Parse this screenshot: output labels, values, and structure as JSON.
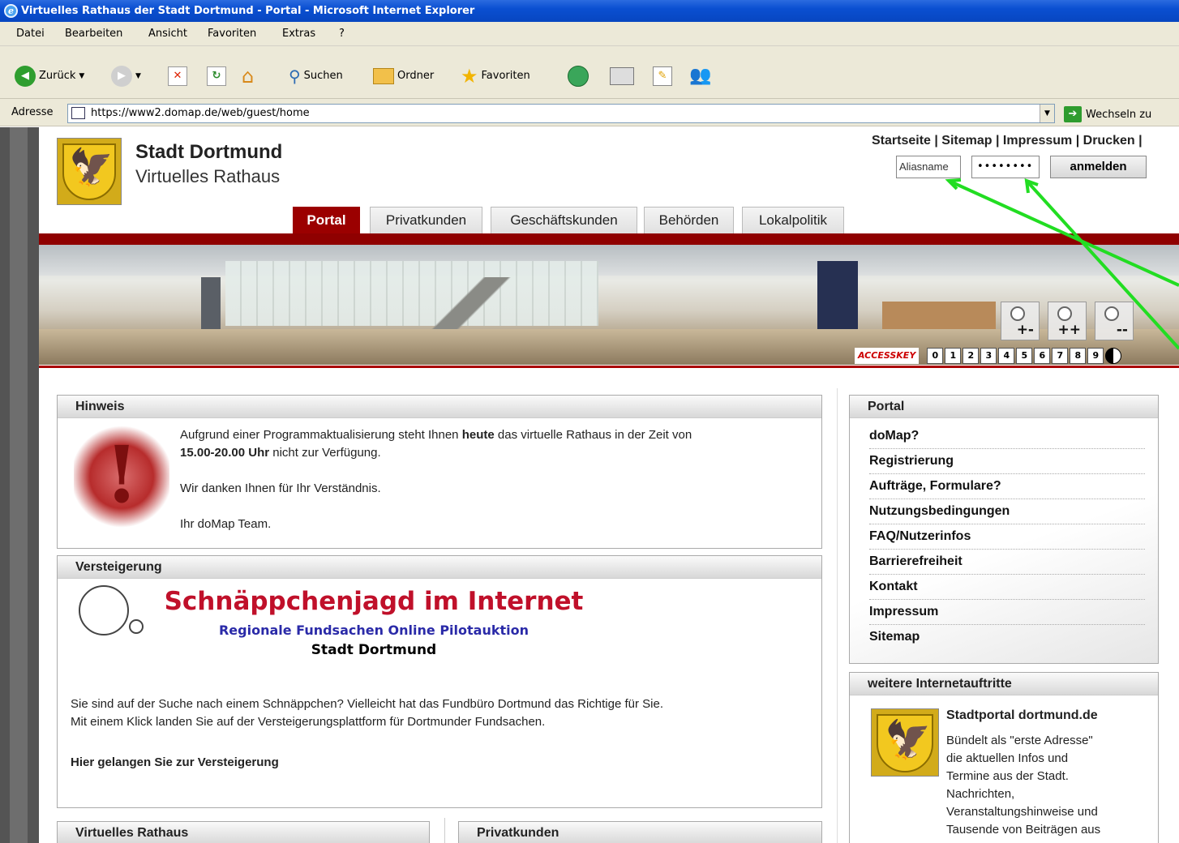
{
  "window": {
    "title": "Virtuelles Rathaus der Stadt Dortmund - Portal - Microsoft Internet Explorer"
  },
  "menu": [
    "Datei",
    "Bearbeiten",
    "Ansicht",
    "Favoriten",
    "Extras",
    "?"
  ],
  "toolbar": {
    "back": "Zurück",
    "search": "Suchen",
    "folders": "Ordner",
    "favorites": "Favoriten"
  },
  "address": {
    "label": "Adresse",
    "url": "https://www2.domap.de/web/guest/home",
    "go": "Wechseln zu"
  },
  "header": {
    "title": "Stadt Dortmund",
    "subtitle": "Virtuelles Rathaus",
    "toplinks": "Startseite | Sitemap | Impressum | Drucken |",
    "alias_value": "Aliasname",
    "password_value": "••••••••",
    "login_label": "anmelden"
  },
  "tabs": [
    "Portal",
    "Privatkunden",
    "Geschäftskunden",
    "Behörden",
    "Lokalpolitik"
  ],
  "accesskey": {
    "label": "ACCESSKEY",
    "keys": [
      "0",
      "1",
      "2",
      "3",
      "4",
      "5",
      "6",
      "7",
      "8",
      "9"
    ]
  },
  "zoom": [
    "+-",
    "++",
    "--"
  ],
  "hinweis": {
    "title": "Hinweis",
    "line1a": "Aufgrund einer Programmaktualisierung steht Ihnen ",
    "line1b": "heute",
    "line1c": " das virtuelle Rathaus in der Zeit von",
    "line2a": "15.00-20.00 Uhr",
    "line2b": " nicht zur Verfügung.",
    "line3": "Wir danken Ihnen für Ihr Verständnis.",
    "line4": "Ihr doMap Team."
  },
  "versteigerung": {
    "title": "Versteigerung",
    "headline": "Schnäppchenjagd im Internet",
    "sub": "Regionale Fundsachen Online Pilotauktion",
    "city": "Stadt Dortmund",
    "text1": "Sie sind auf der Suche nach einem Schnäppchen? Vielleicht hat das Fundbüro Dortmund das Richtige für Sie.",
    "text2": "Mit einem Klick landen Sie auf der Versteigerungsplattform für Dortmunder Fundsachen.",
    "link": "Hier gelangen Sie zur Versteigerung"
  },
  "bottom_panels": [
    "Virtuelles Rathaus",
    "Privatkunden"
  ],
  "portal_nav": {
    "title": "Portal",
    "items": [
      "doMap?",
      "Registrierung",
      "Aufträge, Formulare?",
      "Nutzungsbedingungen",
      "FAQ/Nutzerinfos",
      "Barrierefreiheit",
      "Kontakt",
      "Impressum",
      "Sitemap"
    ]
  },
  "weitere": {
    "title": "weitere Internetauftritte",
    "heading": "Stadtportal dortmund.de",
    "lines": [
      "Bündelt als \"erste Adresse\"",
      "die aktuellen Infos und",
      "Termine aus der Stadt.",
      "Nachrichten,",
      "Veranstaltungshinweise und",
      "Tausende von Beiträgen aus"
    ]
  },
  "colors": {
    "accent": "#9b0000",
    "titlebar": "#0a4fd1",
    "annotation_arrow": "#22dd22"
  }
}
